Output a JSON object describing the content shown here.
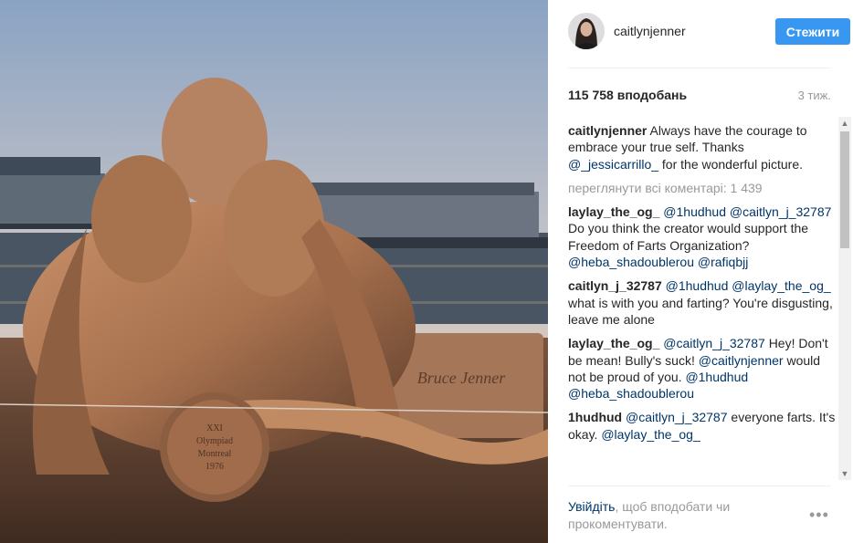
{
  "header": {
    "username": "caitlynjenner",
    "follow_label": "Стежити"
  },
  "stats": {
    "likes": "115 758 вподобань",
    "time_ago": "3 тиж."
  },
  "caption": {
    "author": "caitlynjenner",
    "text_1": "Always have the courage to embrace your true self. Thanks",
    "mention": "@_jessicarrillo_",
    "text_2": "for the wonderful picture."
  },
  "view_all": "переглянути всі коментарі: 1 439",
  "comments": [
    {
      "author": "laylay_the_og_",
      "m1": "@1hudhud",
      "m2": "@caitlyn_j_32787",
      "text": "Do you think the creator would support the Freedom of Farts Organization?",
      "m3": "@heba_shadoublerou",
      "m4": "@rafiqbjj"
    },
    {
      "author": "caitlyn_j_32787",
      "m1": "@1hudhud",
      "m2": "@laylay_the_og_",
      "text": "what is with you and farting? You're disgusting, leave me alone"
    },
    {
      "author": "laylay_the_og_",
      "m1": "@caitlyn_j_32787",
      "text_a": "Hey! Don't be mean! Bully's suck!",
      "m2": "@caitlynjenner",
      "text_b": "would not be proud of you.",
      "m3": "@1hudhud",
      "m4": "@heba_shadoublerou"
    },
    {
      "author": "1hudhud",
      "m1": "@caitlyn_j_32787",
      "text": "everyone farts. It's okay.",
      "m2": "@laylay_the_og_"
    }
  ],
  "footer": {
    "login_link": "Увійдіть",
    "text": ", щоб вподобати чи прокоментувати."
  },
  "more_icon": "•••",
  "photo": {
    "plaque_name": "Bruce Jenner",
    "medal_line1": "XXI",
    "medal_line2": "Olympiad",
    "medal_line3": "Montreal",
    "medal_line4": "1976"
  },
  "colors": {
    "accent": "#3897f0",
    "link": "#003569",
    "muted": "#999999",
    "text": "#262626"
  }
}
